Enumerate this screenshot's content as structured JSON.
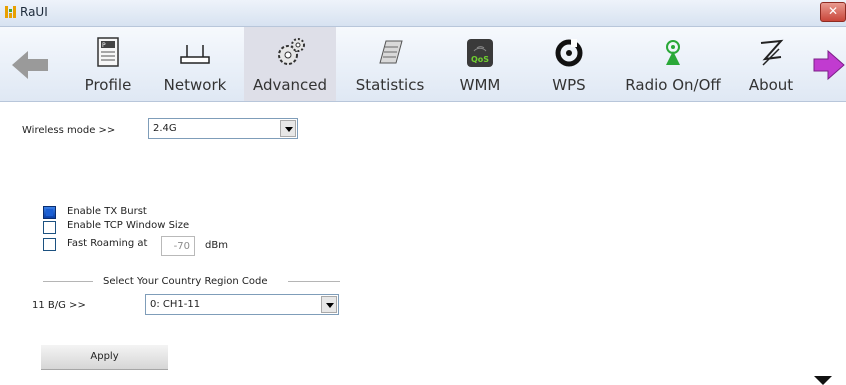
{
  "window": {
    "title": "RaUI",
    "close_label": "✕"
  },
  "toolbar": {
    "items": [
      {
        "label": "Profile",
        "icon": "profile-icon"
      },
      {
        "label": "Network",
        "icon": "network-icon"
      },
      {
        "label": "Advanced",
        "icon": "gears-icon",
        "active": true
      },
      {
        "label": "Statistics",
        "icon": "statistics-icon"
      },
      {
        "label": "WMM",
        "icon": "qos-icon"
      },
      {
        "label": "WPS",
        "icon": "wps-icon"
      },
      {
        "label": "Radio On/Off",
        "icon": "radio-icon"
      },
      {
        "label": "About",
        "icon": "about-icon"
      }
    ]
  },
  "content": {
    "wireless_mode_label": "Wireless mode >>",
    "wireless_mode_value": "2.4G",
    "enable_tx_burst": {
      "label": "Enable TX Burst",
      "checked": true
    },
    "enable_tcp_window": {
      "label": "Enable TCP Window Size",
      "checked": false
    },
    "fast_roaming": {
      "label": "Fast Roaming at",
      "checked": false,
      "value": "-70",
      "unit": "dBm"
    },
    "country_region_title": "Select Your Country Region Code",
    "band_label": "11 B/G >>",
    "band_value": "0: CH1-11",
    "apply_label": "Apply"
  },
  "colors": {
    "titlebar": "#d7e2f1",
    "toolbar": "#dfe8f4",
    "active_tab": "#dedfe8",
    "checkbox_checked": "#1b5fd4"
  }
}
